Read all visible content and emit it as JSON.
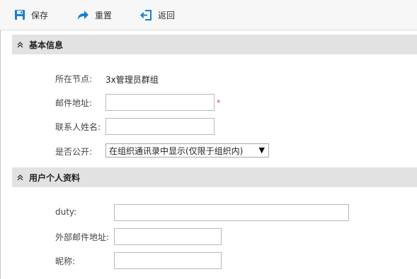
{
  "toolbar": {
    "save_label": "保存",
    "reset_label": "重置",
    "back_label": "返回"
  },
  "sections": {
    "basic": {
      "title": "基本信息"
    },
    "profile": {
      "title": "用户个人资料"
    }
  },
  "basic": {
    "node_label": "所在节点:",
    "node_value": "3x管理员群组",
    "email_label": "邮件地址:",
    "email_value": "",
    "required_mark": "*",
    "contact_label": "联系人姓名:",
    "contact_value": "",
    "public_label": "是否公开:",
    "public_selected": "在组织通讯录中显示(仅限于组织内)",
    "public_arrow": "▼"
  },
  "profile": {
    "duty_label": "duty:",
    "duty_value": "",
    "ext_email_label": "外部邮件地址:",
    "ext_email_value": "",
    "nickname_label": "昵称:",
    "nickname_value": ""
  },
  "colors": {
    "icon_blue": "#1a7fcf",
    "section_bg": "#e2e2e2",
    "required": "#e03a3a"
  },
  "icons": {
    "save": "save-icon",
    "reset": "redo-icon",
    "back": "back-icon",
    "collapse": "chevron-up-double-icon"
  }
}
